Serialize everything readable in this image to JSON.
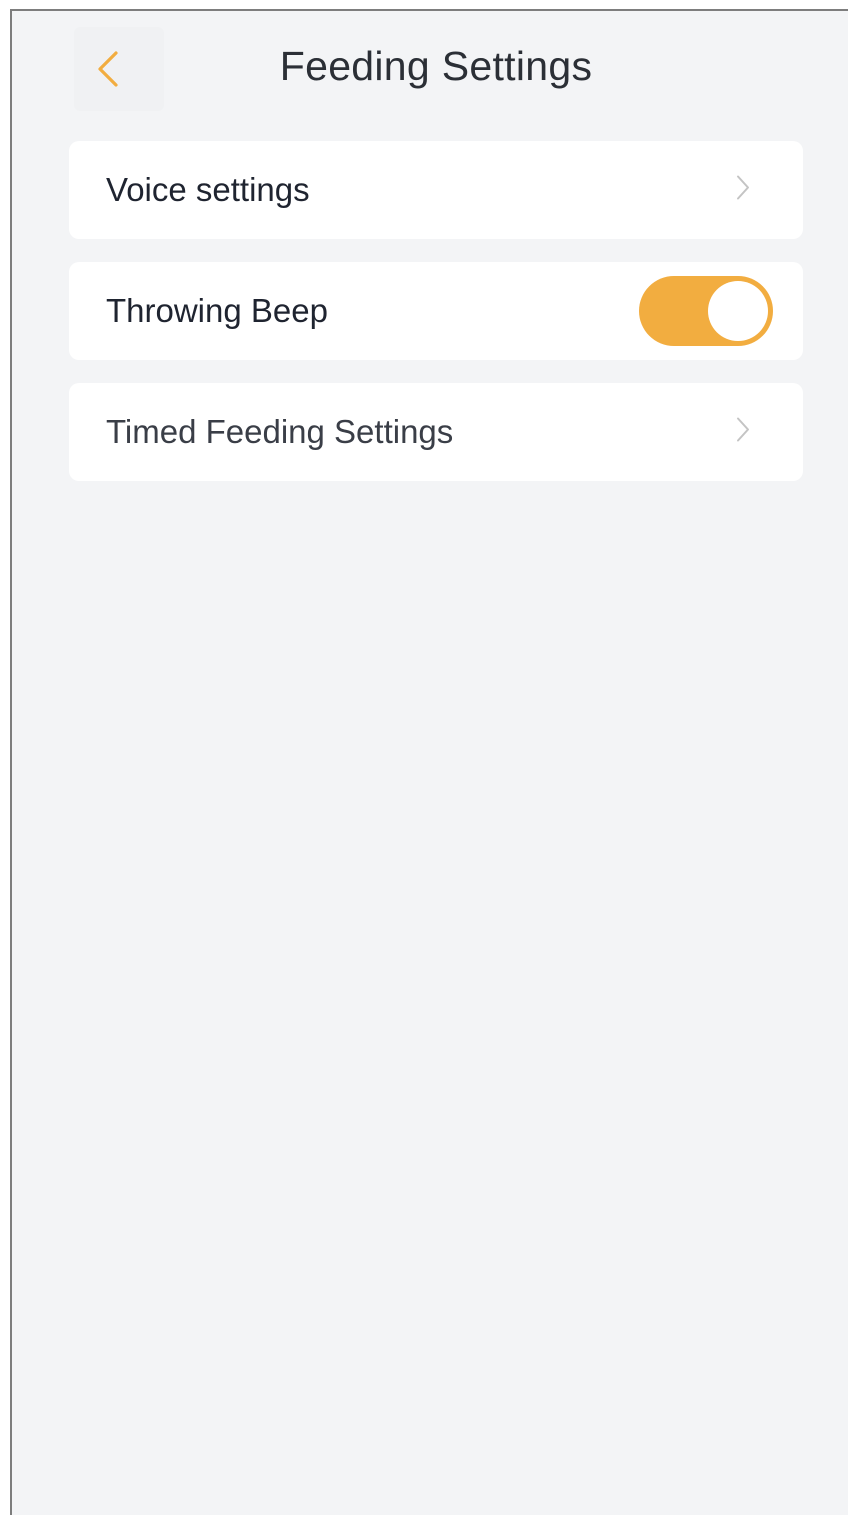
{
  "header": {
    "title": "Feeding Settings",
    "back_icon": "chevron-left-icon"
  },
  "settings": {
    "voice_settings": {
      "label": "Voice settings",
      "icon": "chevron-right-icon"
    },
    "throwing_beep": {
      "label": "Throwing Beep",
      "enabled": true
    },
    "timed_feeding": {
      "label": "Timed Feeding Settings",
      "icon": "chevron-right-icon"
    }
  },
  "colors": {
    "accent": "#f2ad40",
    "background": "#f3f4f6",
    "card": "#ffffff",
    "chevron": "#c4c4c4"
  }
}
